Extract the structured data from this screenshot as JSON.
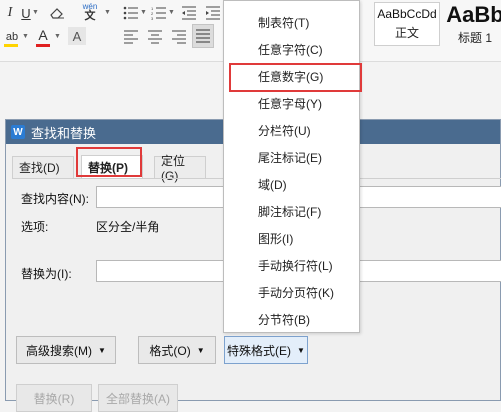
{
  "ribbon": {
    "font_icons": {
      "italic": "I",
      "underline": "U",
      "underline_caret": "▼",
      "strikethrough_ab": "ab",
      "eraser": "eraser",
      "pinyin": "wén",
      "highlight": "ab",
      "font_color": "A",
      "char_shading": "A"
    },
    "styles": {
      "normal_preview": "AaBbCcDd",
      "normal_label": "正文",
      "heading1_preview": "AaBb",
      "heading1_label": "标题 1"
    }
  },
  "dialog": {
    "title": "查找和替换",
    "logo": "W",
    "tabs": [
      "查找(D)",
      "替换(P)",
      "定位(G)"
    ],
    "find_label": "查找内容(N):",
    "find_value": "",
    "options_label": "选项:",
    "options_value": "区分全/半角",
    "replace_label": "替换为(I):",
    "replace_value": "",
    "advanced_search": "高级搜索(M)",
    "format": "格式(O)",
    "special_format": "特殊格式(E)",
    "replace_button": "替换(R)",
    "replace_all_button": "全部替换(A)"
  },
  "dropdown": {
    "items": [
      "制表符(T)",
      "任意字符(C)",
      "任意数字(G)",
      "任意字母(Y)",
      "分栏符(U)",
      "尾注标记(E)",
      "域(D)",
      "脚注标记(F)",
      "图形(I)",
      "手动换行符(L)",
      "手动分页符(K)",
      "分节符(B)"
    ],
    "highlighted": "任意数字(G)"
  },
  "colors": {
    "highlight_box": "#e03a3a",
    "titlebar": "#4a6b8f",
    "font_color_bar": "#e02020",
    "highlight_bar": "#ffd400"
  }
}
